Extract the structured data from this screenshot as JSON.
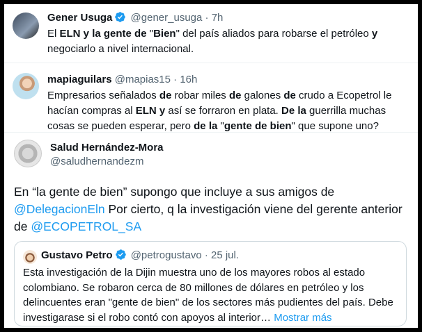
{
  "tweets": [
    {
      "name": "Gener Usuga",
      "handle": "@gener_usuga",
      "time": "· 7h",
      "body": [
        {
          "t": "El ",
          "b": false
        },
        {
          "t": "ELN y la gente de",
          "b": true
        },
        {
          "t": " \"",
          "b": false
        },
        {
          "t": "Bien",
          "b": true
        },
        {
          "t": "\" del país aliados para robarse el petróleo ",
          "b": false
        },
        {
          "t": "y",
          "b": true
        },
        {
          "t": " negociarlo a nivel internacional.",
          "b": false
        }
      ]
    },
    {
      "name": "mapiaguilars",
      "handle": "@mapias15",
      "time": "· 16h",
      "body": [
        {
          "t": "Empresarios señalados ",
          "b": false
        },
        {
          "t": "de",
          "b": true
        },
        {
          "t": " robar miles ",
          "b": false
        },
        {
          "t": "de",
          "b": true
        },
        {
          "t": " galones ",
          "b": false
        },
        {
          "t": "de",
          "b": true
        },
        {
          "t": " crudo a Ecopetrol le hacían compras al ",
          "b": false
        },
        {
          "t": "ELN y",
          "b": true
        },
        {
          "t": " así se forraron en plata. ",
          "b": false
        },
        {
          "t": "De la",
          "b": true
        },
        {
          "t": " guerrilla muchas cosas se pueden esperar, pero ",
          "b": false
        },
        {
          "t": "de la",
          "b": true
        },
        {
          "t": " \"",
          "b": false
        },
        {
          "t": "gente de bien",
          "b": true
        },
        {
          "t": "\" que supone uno?",
          "b": false
        }
      ]
    }
  ],
  "main_tweet": {
    "name": "Salud Hernández-Mora",
    "handle": "@saludhernandezm",
    "text_1": "En “la gente de bien” supongo que incluye a sus amigos de ",
    "mention_1": "@DelegacionEln",
    "text_2": " Por cierto, q la investigación viene del gerente anterior de ",
    "mention_2": "@ECOPETROL_SA"
  },
  "quoted_tweet": {
    "name": "Gustavo Petro",
    "handle": "@petrogustavo",
    "time": "· 25 jul.",
    "body": "Esta investigación de la Dijin muestra uno de los mayores robos al estado colombiano. Se robaron cerca de 80 millones de dólares en petróleo y los delincuentes eran \"gente de bien\" de los sectores más pudientes del país. Debe investigarase si el robo contó con apoyos al interior…",
    "show_more": "Mostrar más"
  },
  "colors": {
    "link": "#1d9bf0",
    "verified": "#1d9bf0",
    "secondary_text": "#536471",
    "border": "#cfd9de"
  }
}
